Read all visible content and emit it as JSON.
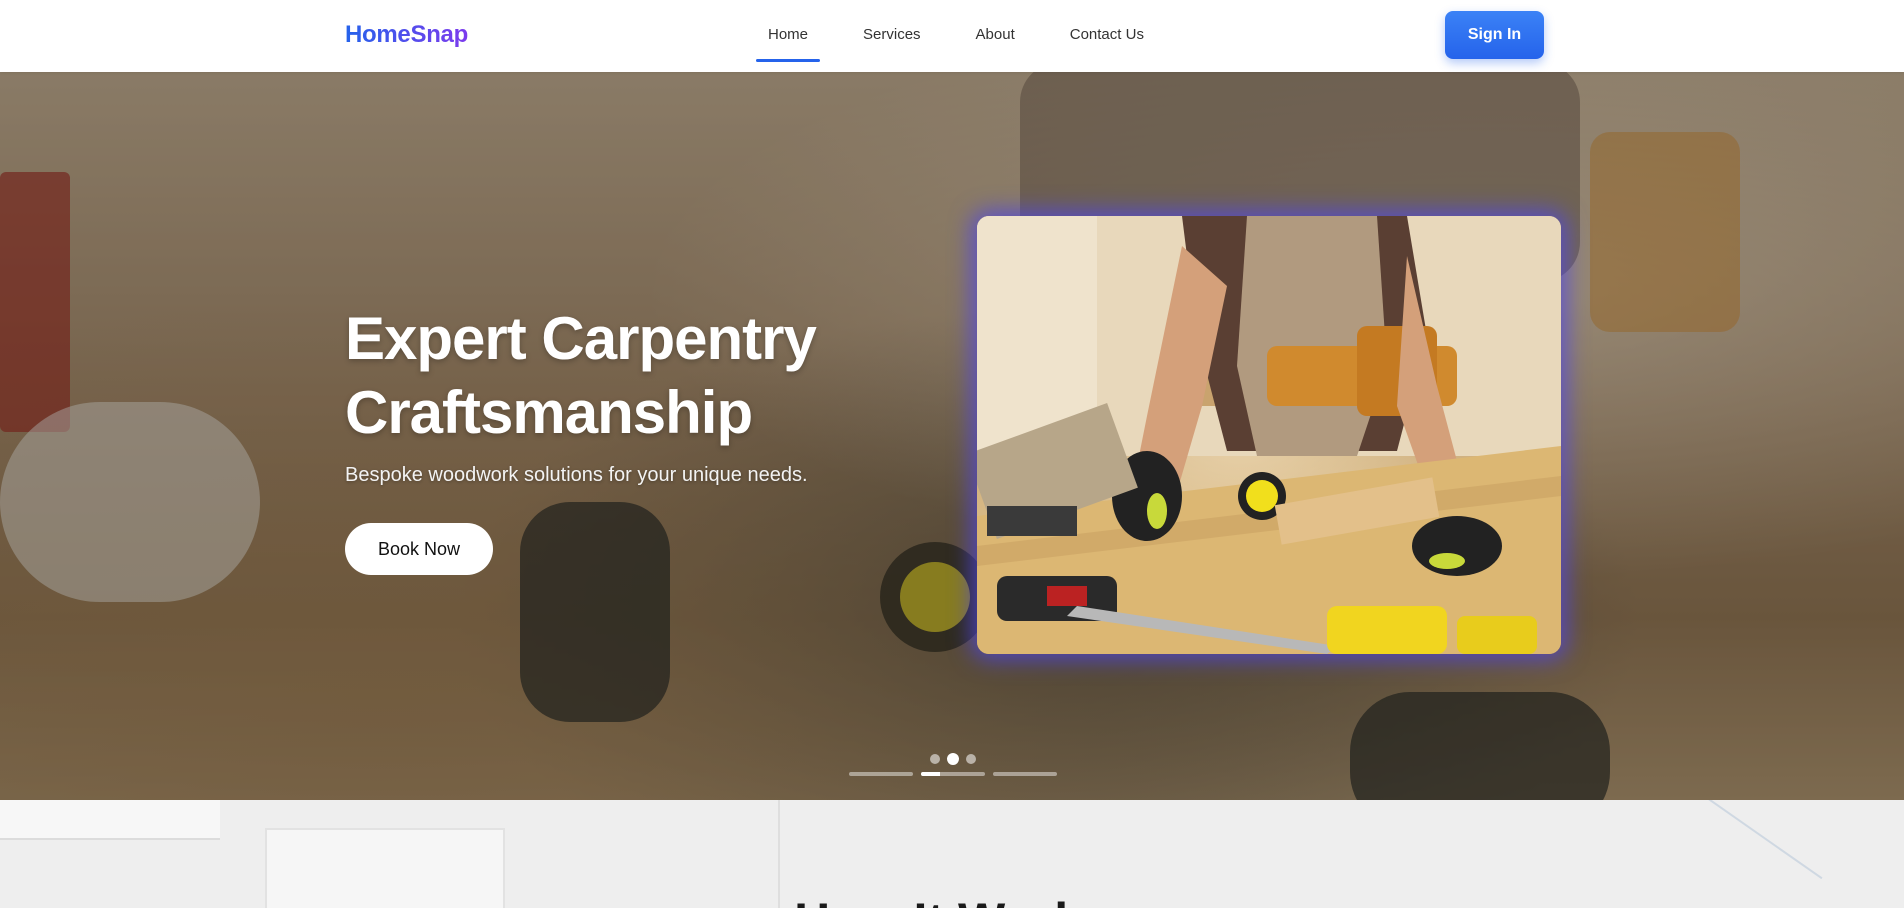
{
  "brand": {
    "name": "HomeSnap",
    "gradient": [
      "#2563eb",
      "#7c3aed"
    ]
  },
  "nav": {
    "items": [
      {
        "label": "Home",
        "active": true
      },
      {
        "label": "Services",
        "active": false
      },
      {
        "label": "About",
        "active": false
      },
      {
        "label": "Contact Us",
        "active": false
      }
    ],
    "sign_in_label": "Sign In"
  },
  "hero": {
    "title_line1": "Expert Carpentry",
    "title_line2": "Craftsmanship",
    "subtitle": "Bespoke woodwork solutions for your unique needs.",
    "cta_label": "Book Now",
    "image_icon": "carpenter-workbench-photo",
    "slide_count": 3,
    "active_slide": 2,
    "slide_progress": [
      0,
      0.3,
      0
    ]
  },
  "how": {
    "title": "How It Works"
  },
  "colors": {
    "accent": "#2563eb",
    "card_glow": "#4f46e5"
  }
}
